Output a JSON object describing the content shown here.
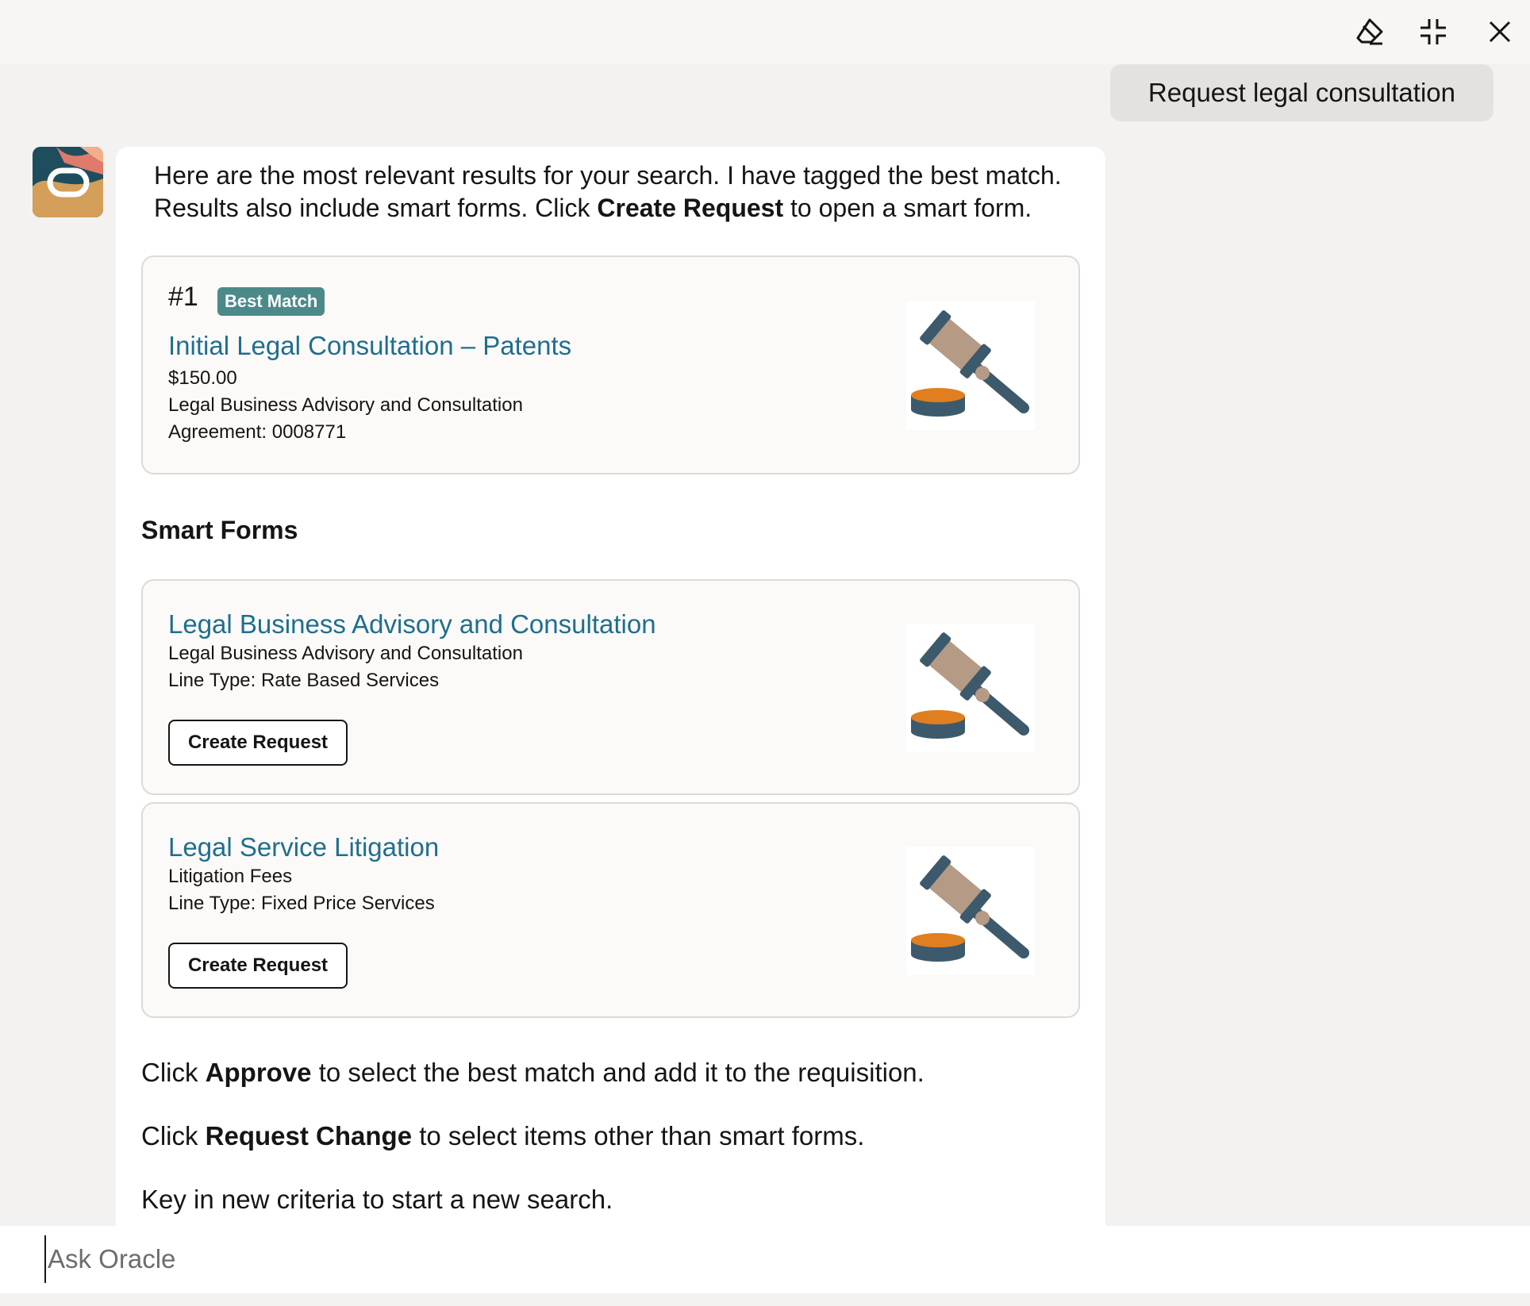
{
  "toolbar": {
    "clear_icon": "eraser-icon",
    "minimize_icon": "collapse-icon",
    "close_icon": "close-icon"
  },
  "user_message": "Request legal consultation",
  "bot": {
    "intro_line1": "Here are the most relevant results for your search. I have tagged the best match.",
    "intro_line2_pre": "Results also include smart forms. Click ",
    "intro_line2_bold": "Create Request",
    "intro_line2_post": " to open a smart form.",
    "best_match": {
      "rank": "#1",
      "badge": "Best Match",
      "title": "Initial Legal Consultation – Patents",
      "price": "$150.00",
      "category": "Legal Business Advisory and Consultation",
      "agreement": "Agreement: 0008771",
      "image_icon": "gavel-icon"
    },
    "smart_forms_heading": "Smart Forms",
    "smart_forms": [
      {
        "title": "Legal Business Advisory and Consultation",
        "subtitle": "Legal Business Advisory and Consultation",
        "line_type": "Line Type: Rate Based Services",
        "button": "Create Request",
        "image_icon": "gavel-icon"
      },
      {
        "title": "Legal Service Litigation",
        "subtitle": "Litigation Fees",
        "line_type": "Line Type: Fixed Price Services",
        "button": "Create Request",
        "image_icon": "gavel-icon"
      }
    ],
    "approve_pre": "Click ",
    "approve_bold": "Approve",
    "approve_post": " to select the best match and add it to the requisition.",
    "change_pre": "Click ",
    "change_bold": "Request Change",
    "change_post": " to select items other than smart forms.",
    "new_search": "Key in new criteria to start a new search."
  },
  "input": {
    "placeholder": "Ask Oracle",
    "value": ""
  },
  "colors": {
    "link": "#1f6e8e",
    "badge": "#4c8a8a",
    "page_background": "#f3f2f1"
  }
}
